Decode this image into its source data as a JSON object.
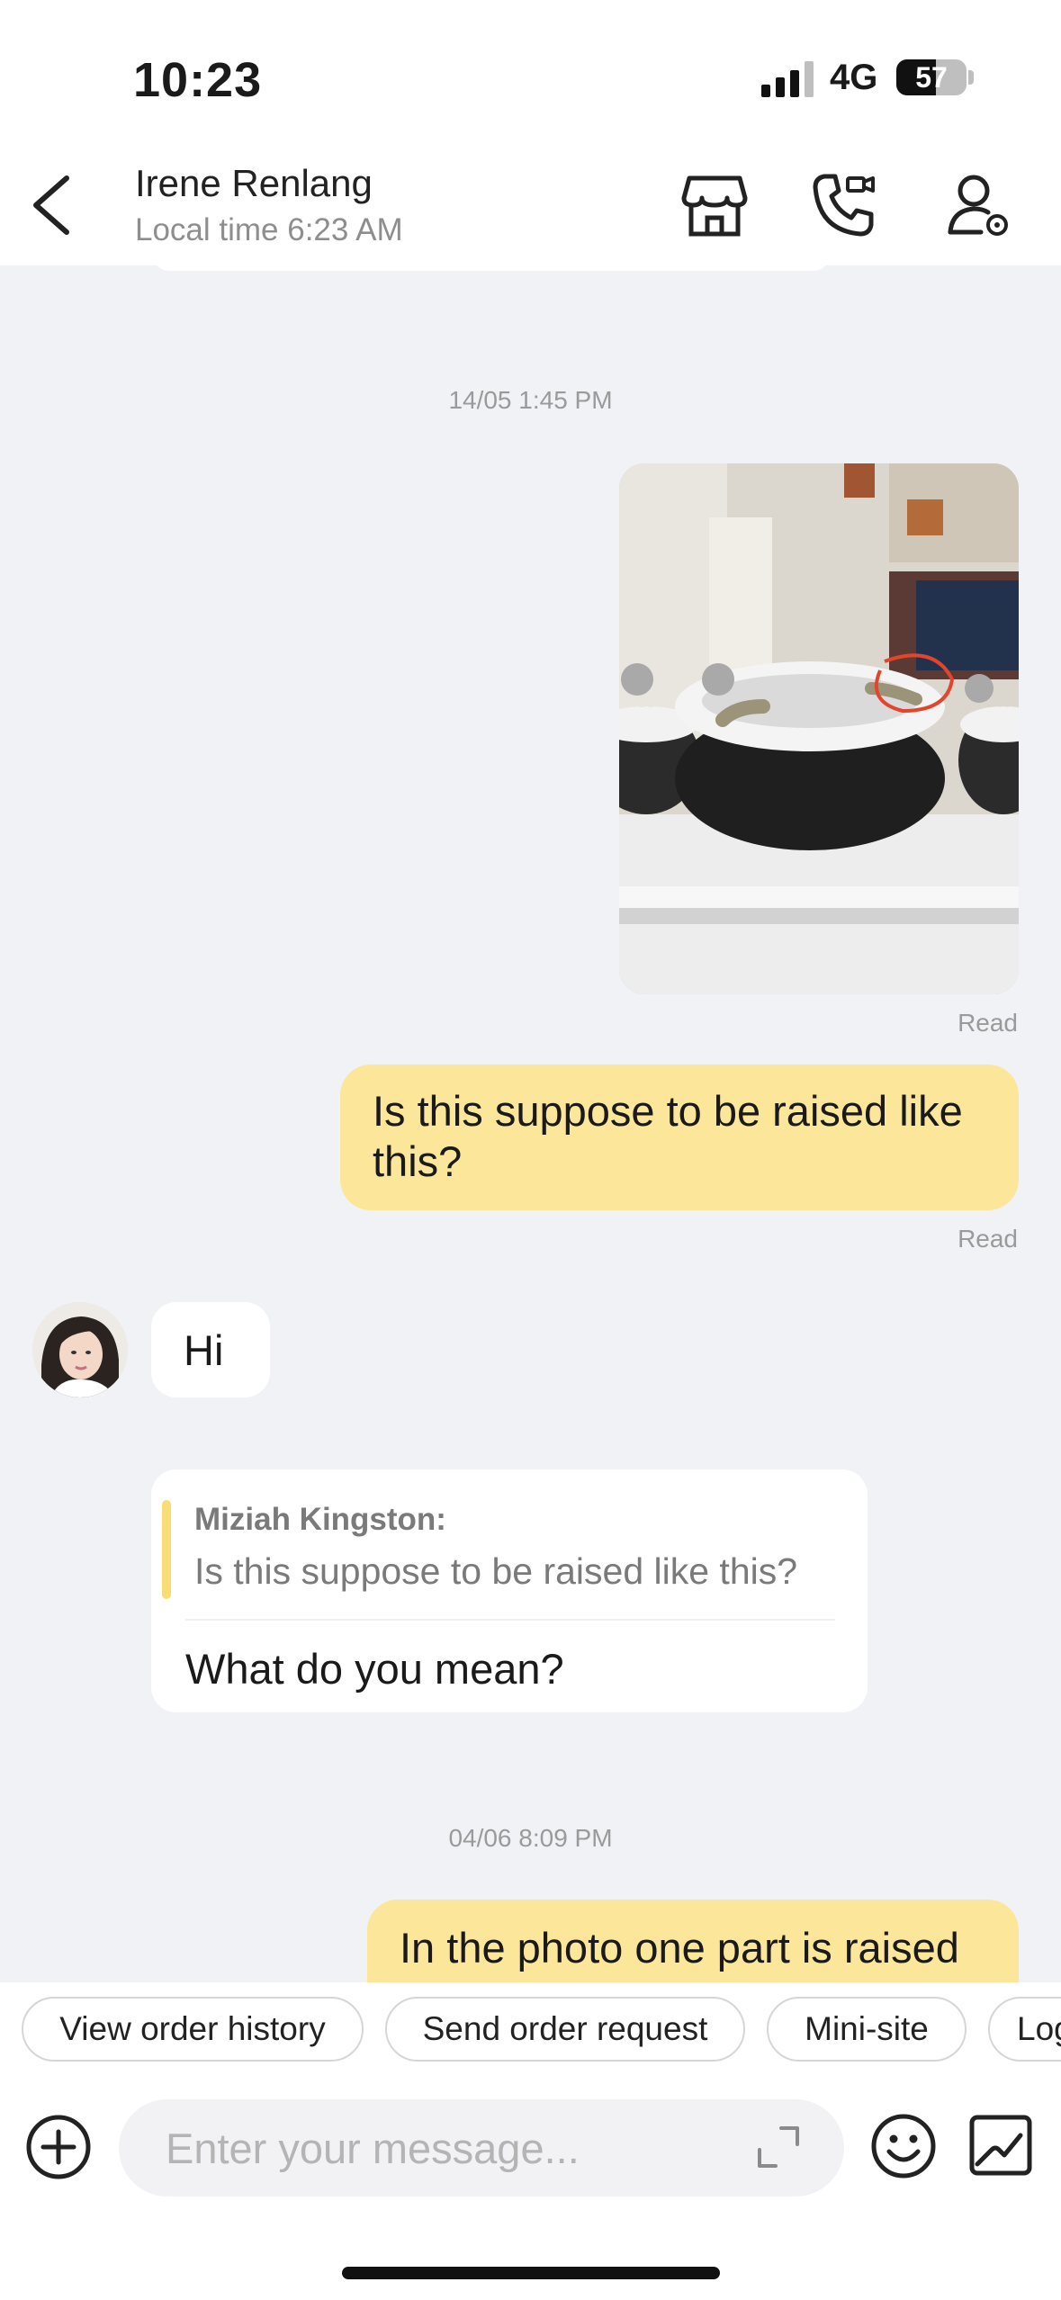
{
  "status_bar": {
    "time": "10:23",
    "network": "4G",
    "battery": "57",
    "battery_level": 0.57
  },
  "header": {
    "contact_name": "Irene Renlang",
    "local_time": "Local time 6:23 AM",
    "icons": [
      "back-icon",
      "storefront-icon",
      "video-call-icon",
      "profile-settings-icon"
    ]
  },
  "messages": {
    "timestamp_1": "14/05 1:45 PM",
    "photo_read": "Read",
    "sent_text_1_line1": "Is this suppose to be raised like",
    "sent_text_1_line2": "this?",
    "sent_text_1_read": "Read",
    "received_hi": "Hi",
    "quote": {
      "author": "Miziah Kingston:",
      "text": "Is this suppose to be raised like this?",
      "reply": "What do you mean?"
    },
    "timestamp_2": "04/06 8:09 PM",
    "sent_text_2": "In the photo one part is raised"
  },
  "quick_actions": [
    "View order history",
    "Send order request",
    "Mini-site",
    "Log"
  ],
  "composer": {
    "placeholder": "Enter your message...",
    "value": ""
  },
  "colors": {
    "sent_bubble": "#FCE69A",
    "quote_bar": "#F7DD73",
    "chat_bg": "#F1F2F6"
  }
}
